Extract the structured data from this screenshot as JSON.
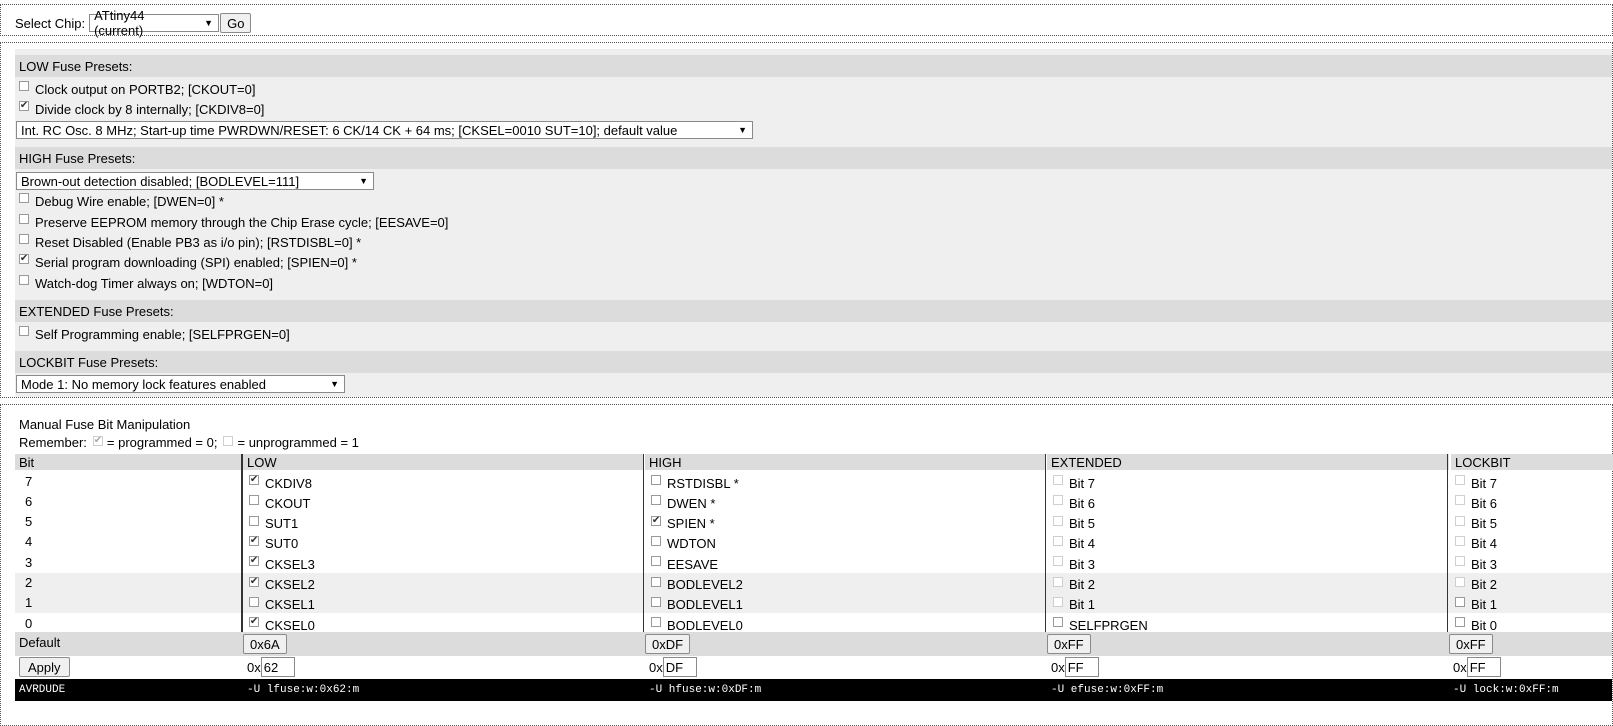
{
  "chip": {
    "label": "Select Chip:",
    "selected": "ATtiny44 (current)",
    "go_label": "Go"
  },
  "presets": {
    "low": {
      "title": "LOW Fuse Presets:",
      "options": [
        {
          "label": "Clock output on PORTB2; [CKOUT=0]",
          "checked": false
        },
        {
          "label": "Divide clock by 8 internally; [CKDIV8=0]",
          "checked": true
        }
      ],
      "select": "Int. RC Osc. 8 MHz; Start-up time PWRDWN/RESET: 6 CK/14 CK + 64 ms; [CKSEL=0010 SUT=10]; default value"
    },
    "high": {
      "title": "HIGH Fuse Presets:",
      "select": "Brown-out detection disabled; [BODLEVEL=111]",
      "options": [
        {
          "label": "Debug Wire enable; [DWEN=0] *",
          "checked": false
        },
        {
          "label": "Preserve EEPROM memory through the Chip Erase cycle; [EESAVE=0]",
          "checked": false
        },
        {
          "label": "Reset Disabled (Enable PB3 as i/o pin); [RSTDISBL=0] *",
          "checked": false
        },
        {
          "label": "Serial program downloading (SPI) enabled; [SPIEN=0] *",
          "checked": true
        },
        {
          "label": "Watch-dog Timer always on; [WDTON=0]",
          "checked": false
        }
      ]
    },
    "extended": {
      "title": "EXTENDED Fuse Presets:",
      "options": [
        {
          "label": "Self Programming enable; [SELFPRGEN=0]",
          "checked": false
        }
      ]
    },
    "lockbit": {
      "title": "LOCKBIT Fuse Presets:",
      "select": "Mode 1: No memory lock features enabled"
    }
  },
  "manual": {
    "title": "Manual Fuse Bit Manipulation",
    "remember_label": "Remember:",
    "programmed_text": "= programmed = 0;",
    "unprogrammed_text": "= unprogrammed = 1",
    "headers": {
      "bit": "Bit",
      "low": "LOW",
      "high": "HIGH",
      "extended": "EXTENDED",
      "lockbit": "LOCKBIT"
    },
    "rows": [
      {
        "bit": "7",
        "low": {
          "name": "CKDIV8",
          "checked": true
        },
        "high": {
          "name": "RSTDISBL *",
          "checked": false
        },
        "ext": {
          "name": "Bit 7",
          "checked": false,
          "disabled": true
        },
        "lock": {
          "name": "Bit 7",
          "checked": false,
          "disabled": true
        }
      },
      {
        "bit": "6",
        "low": {
          "name": "CKOUT",
          "checked": false
        },
        "high": {
          "name": "DWEN *",
          "checked": false
        },
        "ext": {
          "name": "Bit 6",
          "checked": false,
          "disabled": true
        },
        "lock": {
          "name": "Bit 6",
          "checked": false,
          "disabled": true
        }
      },
      {
        "bit": "5",
        "low": {
          "name": "SUT1",
          "checked": false
        },
        "high": {
          "name": "SPIEN *",
          "checked": true
        },
        "ext": {
          "name": "Bit 5",
          "checked": false,
          "disabled": true
        },
        "lock": {
          "name": "Bit 5",
          "checked": false,
          "disabled": true
        }
      },
      {
        "bit": "4",
        "low": {
          "name": "SUT0",
          "checked": true
        },
        "high": {
          "name": "WDTON",
          "checked": false
        },
        "ext": {
          "name": "Bit 4",
          "checked": false,
          "disabled": true
        },
        "lock": {
          "name": "Bit 4",
          "checked": false,
          "disabled": true
        }
      },
      {
        "bit": "3",
        "low": {
          "name": "CKSEL3",
          "checked": true
        },
        "high": {
          "name": "EESAVE",
          "checked": false
        },
        "ext": {
          "name": "Bit 3",
          "checked": false,
          "disabled": true
        },
        "lock": {
          "name": "Bit 3",
          "checked": false,
          "disabled": true
        }
      },
      {
        "bit": "2",
        "low": {
          "name": "CKSEL2",
          "checked": true
        },
        "high": {
          "name": "BODLEVEL2",
          "checked": false
        },
        "ext": {
          "name": "Bit 2",
          "checked": false,
          "disabled": true
        },
        "lock": {
          "name": "Bit 2",
          "checked": false,
          "disabled": true
        }
      },
      {
        "bit": "1",
        "low": {
          "name": "CKSEL1",
          "checked": false
        },
        "high": {
          "name": "BODLEVEL1",
          "checked": false
        },
        "ext": {
          "name": "Bit 1",
          "checked": false,
          "disabled": true
        },
        "lock": {
          "name": "Bit 1",
          "checked": false,
          "disabled": false
        }
      },
      {
        "bit": "0",
        "low": {
          "name": "CKSEL0",
          "checked": true
        },
        "high": {
          "name": "BODLEVEL0",
          "checked": false
        },
        "ext": {
          "name": "SELFPRGEN",
          "checked": false,
          "disabled": false
        },
        "lock": {
          "name": "Bit 0",
          "checked": false,
          "disabled": false
        }
      }
    ],
    "default_label": "Default",
    "defaults": {
      "low": "0x6A",
      "high": "0xDF",
      "ext": "0xFF",
      "lock": "0xFF"
    },
    "apply_label": "Apply",
    "hex_prefix": "0x",
    "values": {
      "low": "62",
      "high": "DF",
      "ext": "FF",
      "lock": "FF"
    },
    "avrdude": {
      "label": "AVRDUDE",
      "low": "-U lfuse:w:0x62:m",
      "high": "-U hfuse:w:0xDF:m",
      "ext": "-U efuse:w:0xFF:m",
      "lock": "-U lock:w:0xFF:m"
    }
  }
}
